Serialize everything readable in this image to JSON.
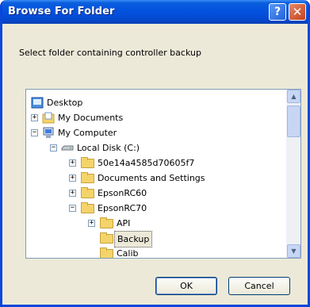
{
  "window": {
    "title": "Browse For Folder",
    "help_label": "?",
    "close_label": "✕"
  },
  "description": "Select folder containing controller backup",
  "tree": [
    {
      "label": "Desktop",
      "icon": "desktop-icon",
      "expander": ""
    },
    {
      "label": "My Documents",
      "icon": "my-documents-icon",
      "expander": "+"
    },
    {
      "label": "My Computer",
      "icon": "my-computer-icon",
      "expander": "−"
    },
    {
      "label": "Local Disk (C:)",
      "icon": "disk-drive-icon",
      "expander": "−"
    },
    {
      "label": "50e14a4585d70605f7",
      "icon": "folder-icon",
      "expander": "+"
    },
    {
      "label": "Documents and Settings",
      "icon": "folder-icon",
      "expander": "+"
    },
    {
      "label": "EpsonRC60",
      "icon": "folder-icon",
      "expander": "+"
    },
    {
      "label": "EpsonRC70",
      "icon": "folder-icon",
      "expander": "−"
    },
    {
      "label": "API",
      "icon": "folder-icon",
      "expander": "+"
    },
    {
      "label": "Backup",
      "icon": "folder-icon",
      "expander": "",
      "selected": true
    },
    {
      "label": "Calib",
      "icon": "folder-icon",
      "expander": ""
    }
  ],
  "buttons": {
    "ok": "OK",
    "cancel": "Cancel"
  }
}
